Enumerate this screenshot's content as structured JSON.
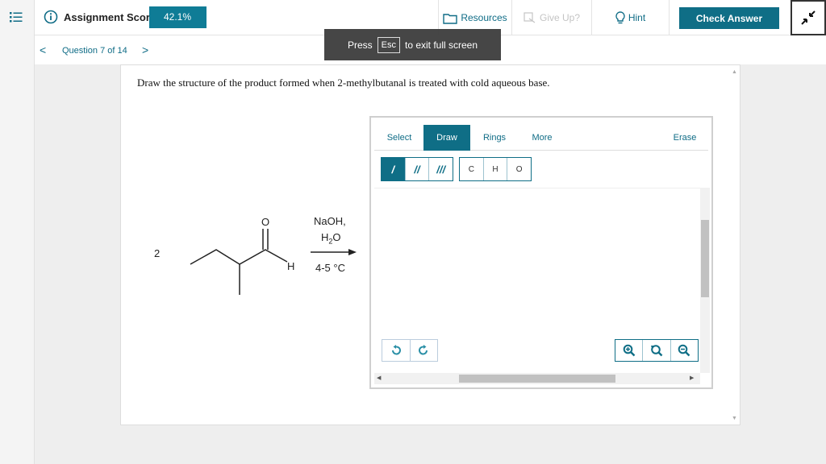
{
  "header": {
    "score_label": "Assignment Score:",
    "score_value": "42.1%",
    "resources_label": "Resources",
    "giveup_label": "Give Up?",
    "hint_label": "Hint",
    "check_label": "Check Answer"
  },
  "nav": {
    "question_label": "Question 7 of 14",
    "prev_symbol": "<",
    "next_symbol": ">"
  },
  "toast": {
    "press": "Press",
    "key": "Esc",
    "rest": "to exit full screen"
  },
  "question_text": "Draw the structure of the product formed when 2-methylbutanal is treated with cold aqueous base.",
  "editor": {
    "tabs": [
      "Select",
      "Draw",
      "Rings",
      "More",
      "Erase"
    ],
    "active_tab": "Draw",
    "bonds": [
      "/",
      "//",
      "///"
    ],
    "atoms": [
      "C",
      "H",
      "O"
    ]
  },
  "reaction": {
    "coefficient": "2",
    "oxygen": "O",
    "hydrogen": "H",
    "reagent_line1": "NaOH,",
    "reagent_h": "H",
    "reagent_sub": "2",
    "reagent_o": "O",
    "condition": "4-5 °C"
  },
  "colors": {
    "accent": "#0f6e86",
    "badge": "#0f7c96"
  }
}
